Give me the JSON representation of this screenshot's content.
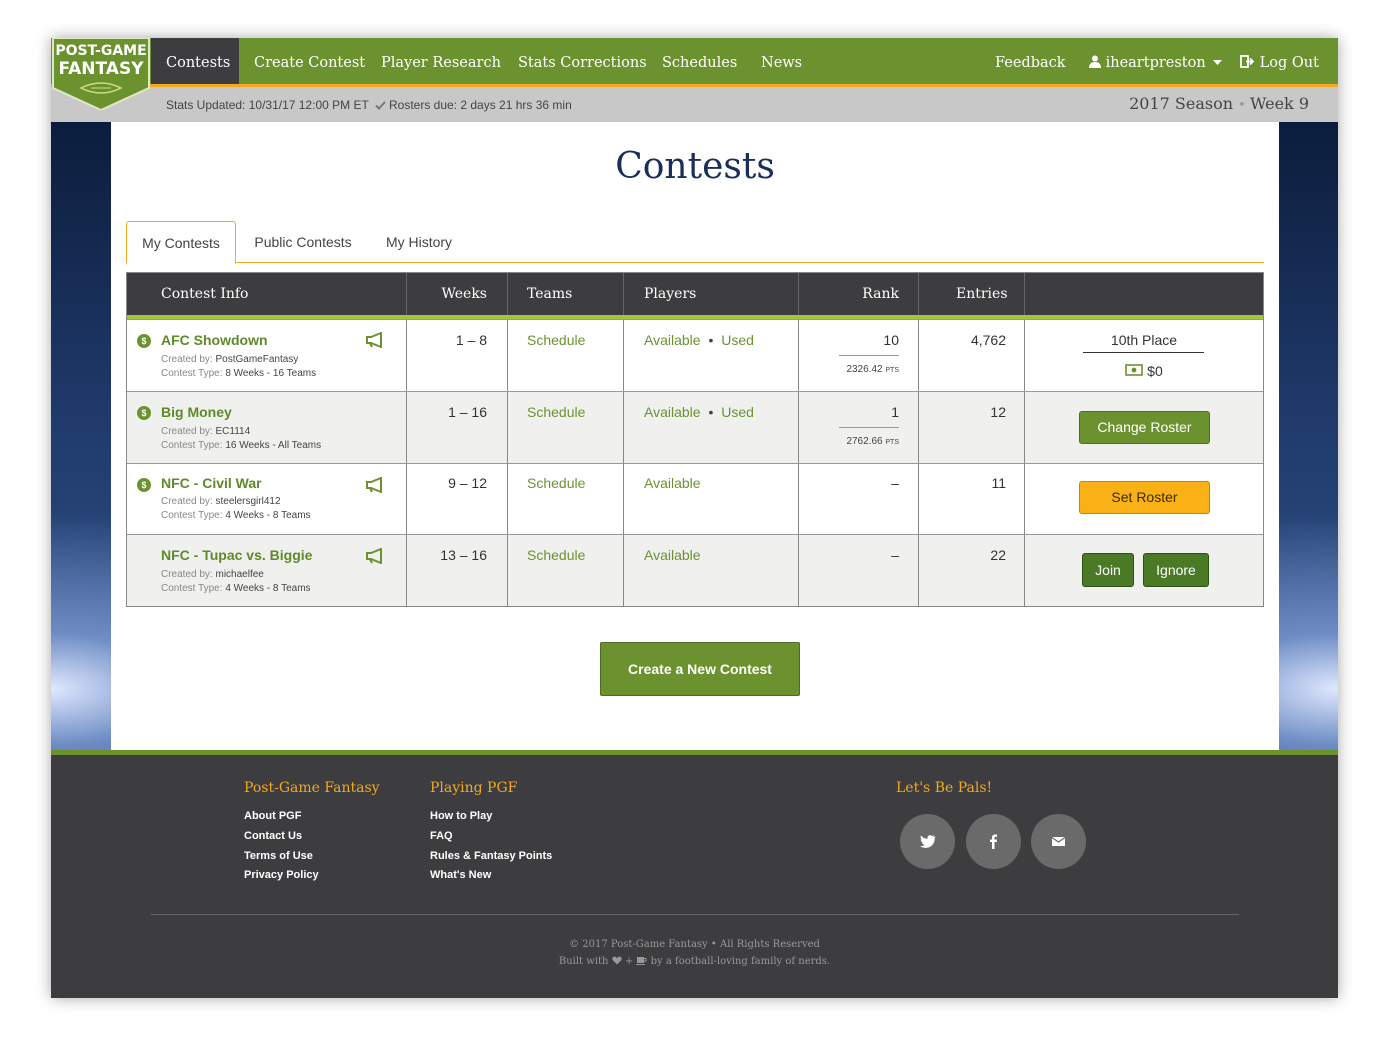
{
  "brand": {
    "line1": "POST-GAME",
    "line2": "FANTASY"
  },
  "nav": {
    "items": [
      "Contests",
      "Create Contest",
      "Player Research",
      "Stats Corrections",
      "Schedules",
      "News"
    ],
    "feedback": "Feedback",
    "user": "iheartpreston",
    "logout": "Log Out"
  },
  "status": {
    "stats_updated": "Stats Updated: 10/31/17 12:00 PM ET",
    "rosters_due": "Rosters due: 2 days 21 hrs 36 min",
    "season": "2017 Season",
    "week": "Week 9"
  },
  "page": {
    "title": "Contests"
  },
  "tabs": [
    "My Contests",
    "Public Contests",
    "My History"
  ],
  "table": {
    "headers": [
      "Contest Info",
      "Weeks",
      "Teams",
      "Players",
      "Rank",
      "Entries",
      ""
    ],
    "rows": [
      {
        "name": "AFC Showdown",
        "created_by_label": "Created by:",
        "created_by": "PostGameFantasy",
        "type_label": "Contest Type:",
        "type": "8 Weeks - 16 Teams",
        "weeks": "1 – 8",
        "teams": "Schedule",
        "available": "Available",
        "sep": "•",
        "used": "Used",
        "rank": "10",
        "pts": "2326.42",
        "pts_unit": "PTS",
        "entries": "4,762",
        "place": "10th Place",
        "prize": "$0"
      },
      {
        "name": "Big Money",
        "created_by_label": "Created by:",
        "created_by": "EC1114",
        "type_label": "Contest Type:",
        "type": "16 Weeks - All Teams",
        "weeks": "1 – 16",
        "teams": "Schedule",
        "available": "Available",
        "sep": "•",
        "used": "Used",
        "rank": "1",
        "pts": "2762.66",
        "pts_unit": "PTS",
        "entries": "12",
        "action": "Change Roster"
      },
      {
        "name": "NFC - Civil War",
        "created_by_label": "Created by:",
        "created_by": "steelersgirl412",
        "type_label": "Contest Type:",
        "type": "4 Weeks - 8 Teams",
        "weeks": "9 – 12",
        "teams": "Schedule",
        "available": "Available",
        "rank": "–",
        "entries": "11",
        "action": "Set Roster"
      },
      {
        "name": "NFC - Tupac vs. Biggie",
        "created_by_label": "Created by:",
        "created_by": "michaelfee",
        "type_label": "Contest Type:",
        "type": "4 Weeks - 8 Teams",
        "weeks": "13 – 16",
        "teams": "Schedule",
        "available": "Available",
        "rank": "–",
        "entries": "22",
        "join": "Join",
        "ignore": "Ignore"
      }
    ]
  },
  "create_button": "Create a New Contest",
  "footer": {
    "col1": {
      "title": "Post-Game Fantasy",
      "links": [
        "About PGF",
        "Contact Us",
        "Terms of Use",
        "Privacy Policy"
      ]
    },
    "col2": {
      "title": "Playing PGF",
      "links": [
        "How to Play",
        "FAQ",
        "Rules & Fantasy Points",
        "What's New"
      ]
    },
    "social": {
      "title": "Let's Be Pals!",
      "icons": [
        "twitter-icon",
        "facebook-icon",
        "envelope-icon"
      ]
    },
    "copyright": "© 2017 Post-Game Fantasy • All Rights Reserved",
    "built_pre": "Built with",
    "built_mid": "+",
    "built_post": "by a football-loving family of nerds."
  },
  "colors": {
    "brand_green": "#6c9230",
    "accent_orange": "#f4a81d",
    "dark": "#3d3d3f",
    "title_navy": "#1b2d5a"
  }
}
